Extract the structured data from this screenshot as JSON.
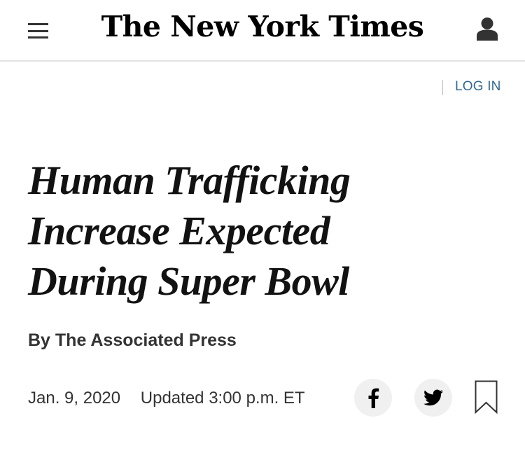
{
  "header": {
    "logo_text": "The New York Times"
  },
  "login": {
    "label": "LOG IN"
  },
  "article": {
    "headline": "Human Trafficking Increase Expected During Super Bowl",
    "byline": "By The Associated Press",
    "date": "Jan. 9, 2020",
    "updated": "Updated 3:00 p.m. ET"
  },
  "colors": {
    "link": "#326891",
    "text": "#121212",
    "share_bg": "#f0f0f0"
  },
  "icons": {
    "menu": "hamburger-menu-icon",
    "user": "user-icon",
    "facebook": "facebook-icon",
    "twitter": "twitter-icon",
    "bookmark": "bookmark-icon"
  }
}
